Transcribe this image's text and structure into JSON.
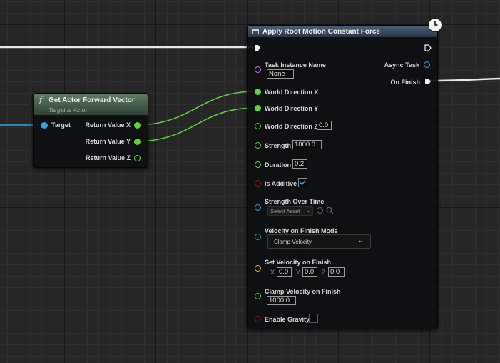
{
  "get_vector_node": {
    "title": "Get Actor Forward Vector",
    "subtitle": "Target is Actor",
    "function_icon": "f",
    "header_color": "#55705a",
    "inputs": [
      {
        "label": "Target",
        "color": "#29a6e8"
      }
    ],
    "outputs": [
      {
        "label": "Return Value X",
        "color": "#5fd43a",
        "connected": true
      },
      {
        "label": "Return Value Y",
        "color": "#5fd43a",
        "connected": true
      },
      {
        "label": "Return Value Z",
        "color": "#5fd43a",
        "connected": false
      }
    ]
  },
  "apply_node": {
    "title": "Apply Root Motion Constant Force",
    "header_color": "#3d4f63",
    "latent_icon": "clock-icon",
    "outputs": {
      "async_task": "Async Task",
      "on_finish": "On Finish"
    },
    "inputs": {
      "task_instance_name": {
        "label": "Task Instance Name",
        "value": "None",
        "color": "#c878f0"
      },
      "world_direction_x": {
        "label": "World Direction X",
        "color": "#5fd43a"
      },
      "world_direction_y": {
        "label": "World Direction Y",
        "color": "#5fd43a"
      },
      "world_direction_z": {
        "label": "World Direction Z",
        "value": "0.0",
        "color": "#5fd43a"
      },
      "strength": {
        "label": "Strength",
        "value": "1000.0",
        "color": "#5fd43a"
      },
      "duration": {
        "label": "Duration",
        "value": "0.2",
        "color": "#5fd43a"
      },
      "is_additive": {
        "label": "Is Additive",
        "checked": true,
        "color": "#a01010"
      },
      "strength_over_time": {
        "label": "Strength Over Time",
        "placeholder": "Select Asset",
        "color": "#29a6e8"
      },
      "velocity_on_finish_mode": {
        "label": "Velocity on Finish Mode",
        "value": "Clamp Velocity",
        "color": "#12a0a0"
      },
      "set_velocity_on_finish": {
        "label": "Set Velocity on Finish",
        "x_label": "X",
        "x": "0.0",
        "y_label": "Y",
        "y": "0.0",
        "z_label": "Z",
        "z": "0.0",
        "color": "#f0b030"
      },
      "clamp_velocity_on_finish": {
        "label": "Clamp Velocity on Finish",
        "value": "1000.0",
        "color": "#5fd43a"
      },
      "enable_gravity": {
        "label": "Enable Gravity",
        "checked": false,
        "color": "#a01010"
      }
    }
  }
}
